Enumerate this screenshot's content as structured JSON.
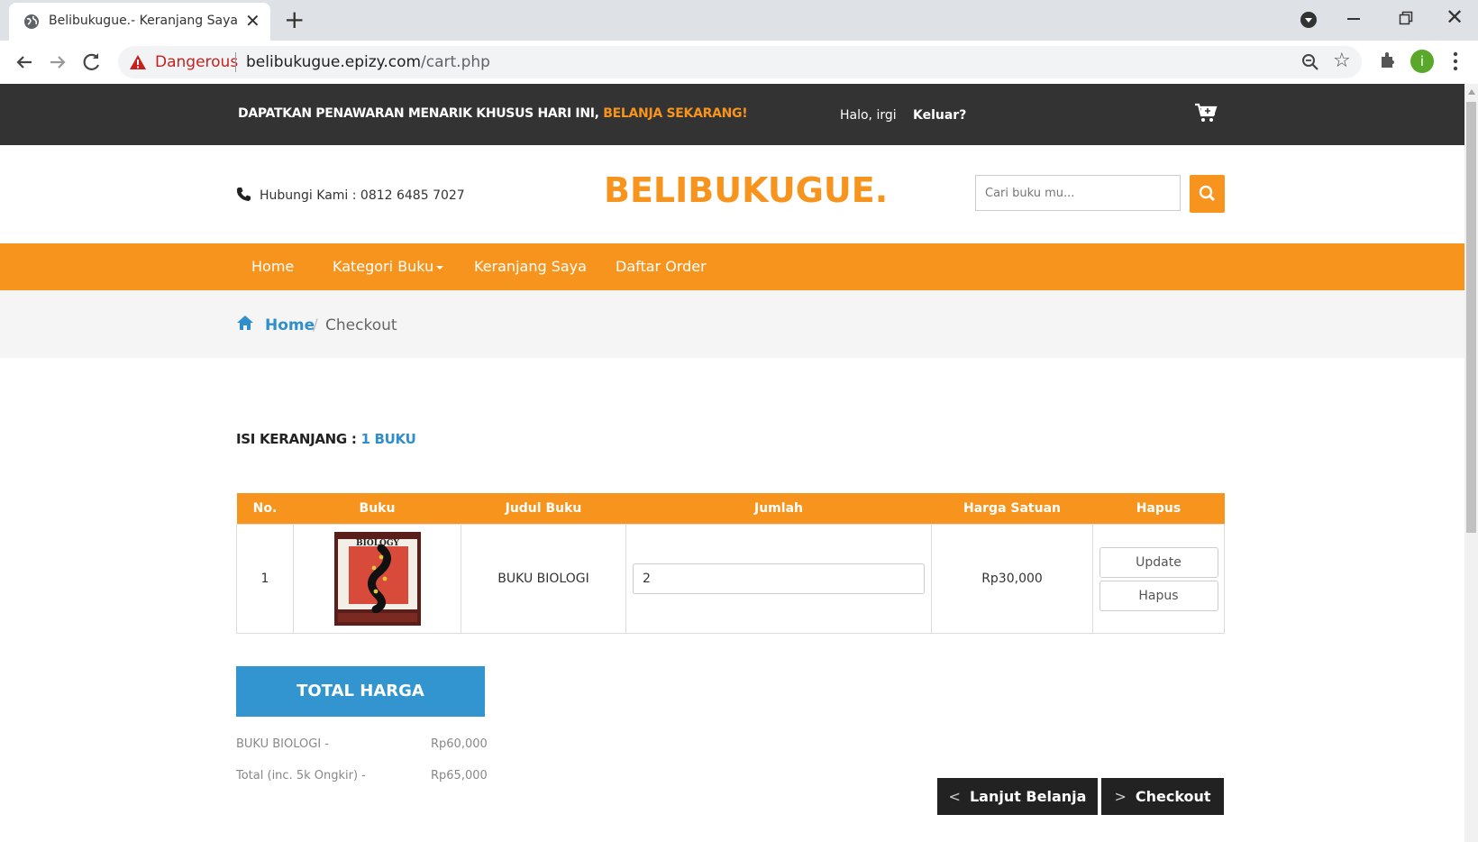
{
  "browser": {
    "tab_title": "Belibukugue.- Keranjang Saya",
    "security_label": "Dangerous",
    "url_host": "belibukugue.epizy.com",
    "url_path": "/cart.php",
    "profile_initial": "i"
  },
  "topbar": {
    "promo_text": "DAPATKAN PENAWARAN MENARIK KHUSUS HARI INI, ",
    "promo_link": "BELANJA SEKARANG!",
    "greeting": "Halo, irgi",
    "logout": "Keluar?"
  },
  "header": {
    "contact": "Hubungi Kami : 0812 6485 7027",
    "logo": "BELIBUKUGUE.",
    "search_placeholder": "Cari buku mu..."
  },
  "nav": {
    "items": [
      "Home",
      "Kategori Buku",
      "Keranjang Saya",
      "Daftar Order"
    ]
  },
  "breadcrumb": {
    "home": "Home",
    "separator": "/",
    "current": "Checkout"
  },
  "cart": {
    "heading_label": "ISI KERANJANG : ",
    "heading_count": "1 BUKU",
    "columns": [
      "No.",
      "Buku",
      "Judul Buku",
      "Jumlah",
      "Harga Satuan",
      "Hapus"
    ],
    "rows": [
      {
        "no": "1",
        "cover_text": "BIOLOGY",
        "title": "BUKU BIOLOGI",
        "qty": "2",
        "price": "Rp30,000",
        "update_label": "Update",
        "delete_label": "Hapus"
      }
    ]
  },
  "summary": {
    "title": "TOTAL HARGA",
    "lines": [
      {
        "label": "BUKU BIOLOGI -",
        "value": "Rp60,000"
      },
      {
        "label": "Total (inc. 5k Ongkir) -",
        "value": "Rp65,000"
      }
    ]
  },
  "actions": {
    "continue_label": "Lanjut Belanja",
    "checkout_label": "Checkout"
  },
  "colors": {
    "accent": "#f7941d",
    "topbar": "#333333",
    "link_blue": "#2f8fcc",
    "total_blue": "#3395cf"
  }
}
